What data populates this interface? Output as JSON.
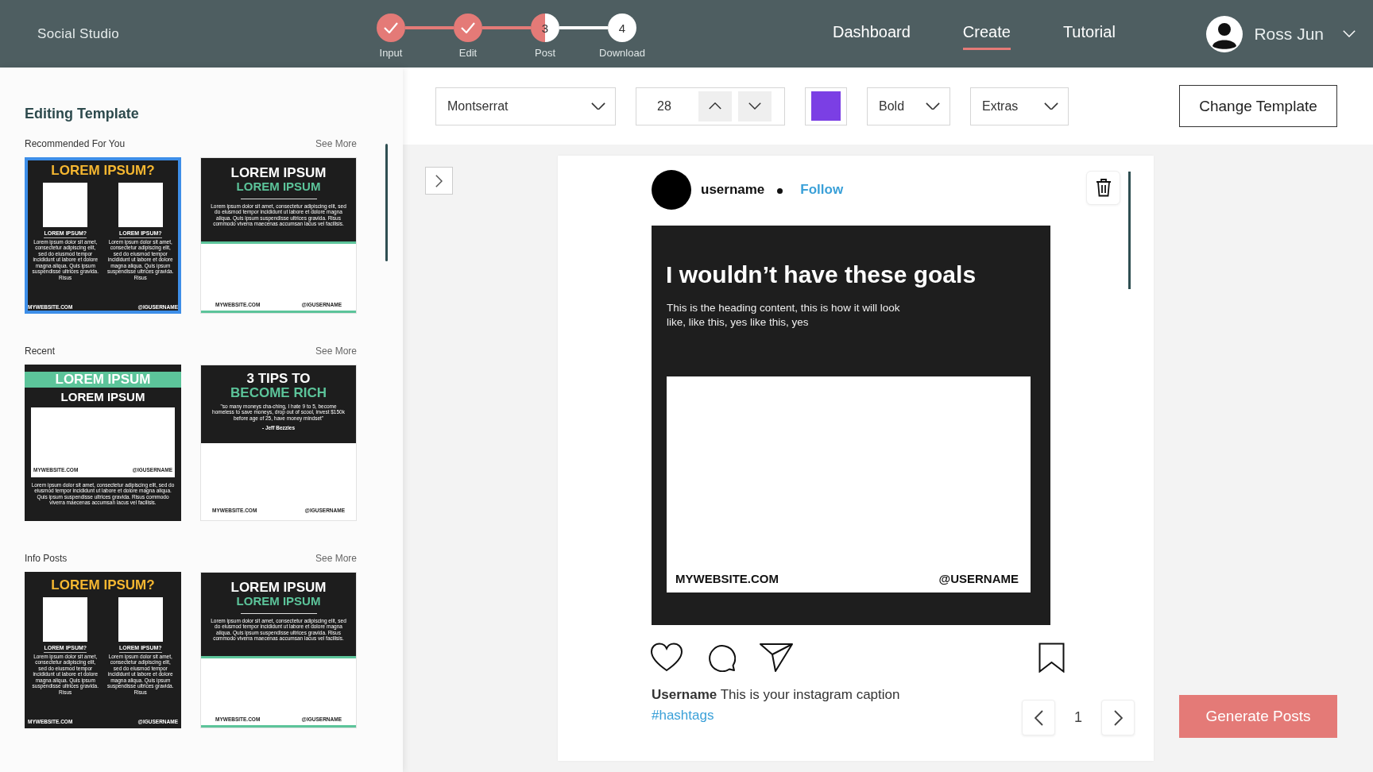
{
  "app": {
    "title": "Social Studio"
  },
  "steps": [
    {
      "label": "Input",
      "completed": true,
      "current": false
    },
    {
      "label": "Edit",
      "completed": true,
      "current": false
    },
    {
      "label": "Post",
      "number": "3",
      "completed": false,
      "current": true
    },
    {
      "label": "Download",
      "number": "4",
      "completed": false,
      "current": false
    }
  ],
  "nav": [
    {
      "label": "Dashboard",
      "selected": false
    },
    {
      "label": "Create",
      "selected": true
    },
    {
      "label": "Tutorial",
      "selected": false
    }
  ],
  "user": {
    "name": "Ross Jun"
  },
  "sidebar": {
    "title": "Editing Template",
    "sections": [
      {
        "label": "Recommended For You",
        "link": "See More",
        "templates": [
          {
            "kind": "two-up",
            "selected": true,
            "title": "LOREM IPSUM?",
            "columns": [
              {
                "heading": "LOREM IPSUM?",
                "body": "Lorem ipsum dolor sit amet, consectetur adipiscing elit, sed do eiusmod tempor incididunt ut labore et dolore magna aliqua. Quis ipsum suspendisse ultrices gravida. Risus"
              },
              {
                "heading": "LOREM IPSUM?",
                "body": "Lorem ipsum dolor sit amet, consectetur adipiscing elit, sed do eiusmod tempor incididunt ut labore et dolore magna aliqua. Quis ipsum suspendisse ultrices gravida. Risus"
              }
            ],
            "footer_left": "MYWEBSITE.COM",
            "footer_right": "@IGUSERNAME"
          },
          {
            "kind": "banner",
            "selected": false,
            "title": "LOREM IPSUM",
            "subtitle": "LOREM IPSUM",
            "body": "Lorem ipsum dolor sit amet, consectetur adipiscing elit, sed do eiusmod tempor incididunt ut labore et dolore magna aliqua. Quis ipsum suspendisse ultrices gravida. Risus commodo viverra maecenas accumsan lacus vel facilisis.",
            "footer_left": "MYWEBSITE.COM",
            "footer_right": "@IGUSERNAME"
          }
        ]
      },
      {
        "label": "Recent",
        "link": "See More",
        "templates": [
          {
            "kind": "header-bar",
            "selected": false,
            "title": "LOREM IPSUM",
            "subtitle": "LOREM IPSUM",
            "footer_left": "MYWEBSITE.COM",
            "footer_right": "@IGUSERNAME",
            "body": "Lorem ipsum dolor sit amet, consectetur adipiscing elit, sed do eiusmod tempor incididunt ut labore et dolore magna aliqua. Quis ipsum suspendisse ultrices gravida. Risus commodo viverra maecenas accumsan lacus vel facilisis."
          },
          {
            "kind": "quote",
            "selected": false,
            "title": "3 TIPS TO",
            "subtitle": "BECOME RICH",
            "body": "\"so many moneys cha-ching, I hate 9 to 5, become homeless to save moneys, drop out of scool, invest $150k before age of 25, have money mindset\"",
            "author": "- Jeff Bezzies",
            "footer_left": "MYWEBSITE.COM",
            "footer_right": "@IGUSERNAME"
          }
        ]
      },
      {
        "label": "Info Posts",
        "link": "See More",
        "templates": [
          {
            "kind": "two-up",
            "selected": false,
            "title": "LOREM IPSUM?",
            "columns": [
              {
                "heading": "LOREM IPSUM?",
                "body": "Lorem ipsum dolor sit amet, consectetur adipiscing elit, sed do eiusmod tempor incididunt ut labore et dolore magna aliqua. Quis ipsum suspendisse ultrices gravida. Risus"
              },
              {
                "heading": "LOREM IPSUM?",
                "body": "Lorem ipsum dolor sit amet, consectetur adipiscing elit, sed do eiusmod tempor incididunt ut labore et dolore magna aliqua. Quis ipsum suspendisse ultrices gravida. Risus"
              }
            ],
            "footer_left": "MYWEBSITE.COM",
            "footer_right": "@IGUSERNAME"
          },
          {
            "kind": "banner",
            "selected": false,
            "title": "LOREM IPSUM",
            "subtitle": "LOREM IPSUM",
            "body": "Lorem ipsum dolor sit amet, consectetur adipiscing elit, sed do eiusmod tempor incididunt ut labore et dolore magna aliqua. Quis ipsum suspendisse ultrices gravida. Risus commodo viverra maecenas accumsan lacus vel facilisis.",
            "footer_left": "MYWEBSITE.COM",
            "footer_right": "@IGUSERNAME"
          }
        ]
      }
    ]
  },
  "toolbar": {
    "font": "Montserrat",
    "size": "28",
    "swatch": {
      "color": "#7b3fe4"
    },
    "weight": "Bold",
    "extras": "Extras",
    "change_template": "Change Template"
  },
  "post": {
    "username": "username",
    "follow": "Follow",
    "heading": "I wouldn’t have these goals",
    "body": "This is the heading content, this is how it will look like, like this, yes like this, yes",
    "footer_left": "MYWEBSITE.COM",
    "footer_right": "@USERNAME",
    "caption": "**Username** This is your instagram caption",
    "hashtags": "#hashtags"
  },
  "pager": {
    "page": "1"
  },
  "generate": "Generate Posts"
}
